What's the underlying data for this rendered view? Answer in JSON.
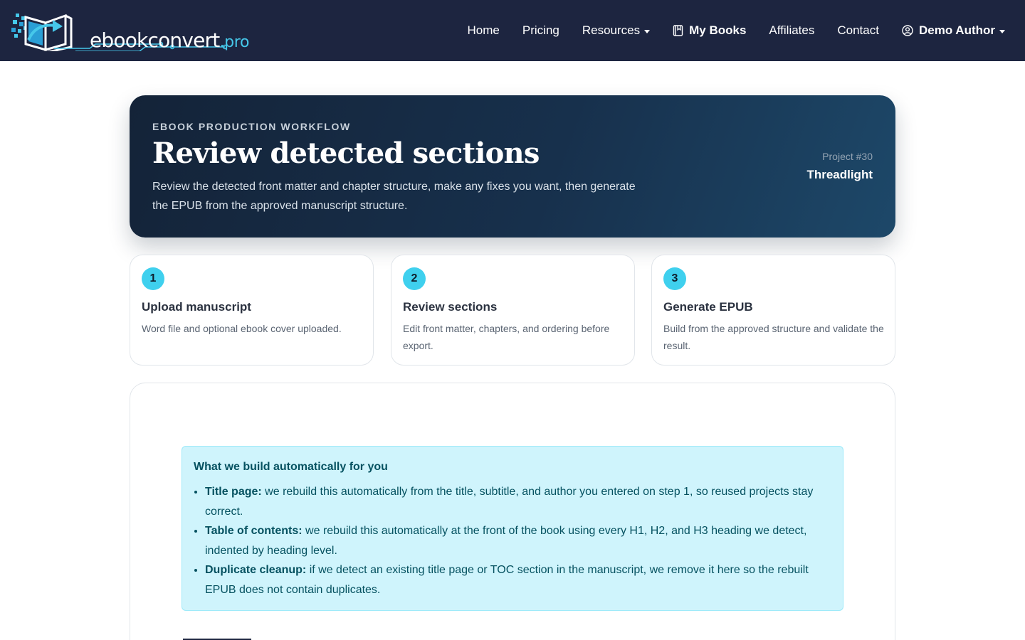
{
  "brand": {
    "name_main": "ebookconvert",
    "name_suffix": ".pro"
  },
  "nav": {
    "items": [
      {
        "label": "Home"
      },
      {
        "label": "Pricing"
      },
      {
        "label": "Resources"
      },
      {
        "label": "My Books"
      },
      {
        "label": "Affiliates"
      },
      {
        "label": "Contact"
      },
      {
        "label": "Demo Author"
      }
    ]
  },
  "hero": {
    "eyebrow": "EBOOK PRODUCTION WORKFLOW",
    "title": "Review detected sections",
    "description": "Review the detected front matter and chapter structure, make any fixes you want, then generate the EPUB from the approved manuscript structure.",
    "project_label": "Project #30",
    "project_name": "Threadlight"
  },
  "steps": [
    {
      "number": "1",
      "title": "Upload manuscript",
      "description": "Word file and optional ebook cover uploaded."
    },
    {
      "number": "2",
      "title": "Review sections",
      "description": "Edit front matter, chapters, and ordering before export."
    },
    {
      "number": "3",
      "title": "Generate EPUB",
      "description": "Build from the approved structure and validate the result."
    }
  ],
  "info": {
    "title": "What we build automatically for you",
    "items": [
      {
        "term": "Title page:",
        "text": " we rebuild this automatically from the title, subtitle, and author you entered on step 1, so reused projects stay correct."
      },
      {
        "term": "Table of contents:",
        "text": " we rebuild this automatically at the front of the book using every H1, H2, and H3 heading we detect, indented by heading level."
      },
      {
        "term": "Duplicate cleanup:",
        "text": " if we detect an existing title page or TOC section in the manuscript, we remove it here so the rebuilt EPUB does not contain duplicates."
      }
    ]
  },
  "colors": {
    "navbar_bg": "#1d2540",
    "accent": "#3fd0ee",
    "brand_suffix": "#46c8ea",
    "info_bg": "#cff4fc",
    "info_text": "#055160"
  },
  "icons": {
    "logo": "open-book-arrow-logo",
    "my_books": "book-icon",
    "account": "user-circle-icon",
    "dropdown": "caret-down-icon"
  }
}
